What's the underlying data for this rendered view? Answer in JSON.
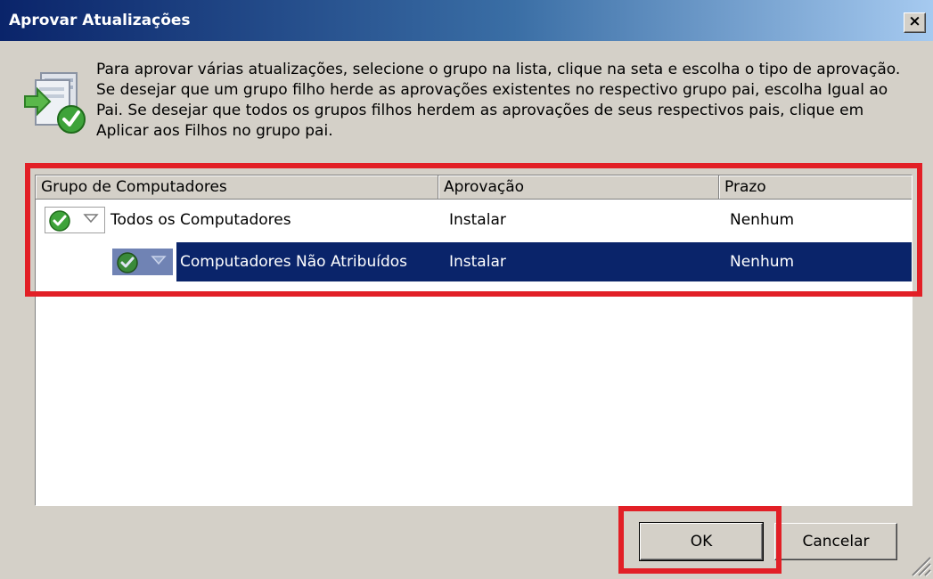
{
  "window": {
    "title": "Aprovar Atualizações",
    "close_glyph": "×"
  },
  "instructions": "Para aprovar várias atualizações, selecione o grupo na lista, clique na seta e escolha o tipo de aprovação. Se desejar que um grupo filho herde as aprovações existentes no respectivo grupo pai, escolha Igual ao Pai. Se desejar que todos os grupos filhos herdem as aprovações de seus respectivos pais, clique em Aplicar aos Filhos no grupo pai.",
  "list": {
    "columns": [
      "Grupo de Computadores",
      "Aprovação",
      "Prazo"
    ],
    "rows": [
      {
        "group": "Todos os Computadores",
        "approval": "Instalar",
        "deadline": "Nenhum",
        "selected": false,
        "state_icon": "check-icon"
      },
      {
        "group": "Computadores Não Atribuídos",
        "approval": "Instalar",
        "deadline": "Nenhum",
        "selected": true,
        "state_icon": "check-icon"
      }
    ]
  },
  "buttons": {
    "ok": "OK",
    "cancel": "Cancelar"
  },
  "colors": {
    "title_bar": "#0a246a",
    "selection": "#0a246a",
    "highlight": "#e21f26",
    "check_green": "#3ea33a"
  }
}
